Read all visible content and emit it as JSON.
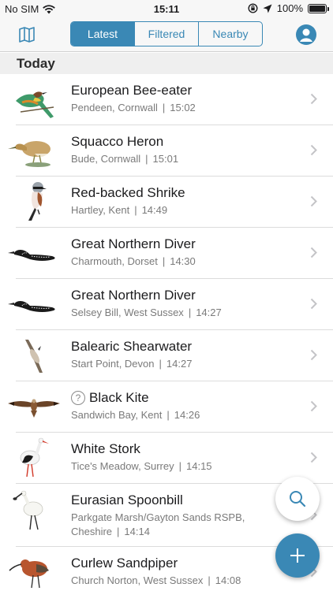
{
  "status_bar": {
    "carrier": "No SIM",
    "time": "15:11",
    "battery": "100%"
  },
  "nav": {
    "tabs": [
      {
        "label": "Latest",
        "active": true
      },
      {
        "label": "Filtered",
        "active": false
      },
      {
        "label": "Nearby",
        "active": false
      }
    ]
  },
  "section": {
    "title": "Today"
  },
  "sightings": [
    {
      "species": "European Bee-eater",
      "location": "Pendeen, Cornwall",
      "time": "15:02"
    },
    {
      "species": "Squacco Heron",
      "location": "Bude, Cornwall",
      "time": "15:01"
    },
    {
      "species": "Red-backed Shrike",
      "location": "Hartley, Kent",
      "time": "14:49"
    },
    {
      "species": "Great Northern Diver",
      "location": "Charmouth, Dorset",
      "time": "14:30"
    },
    {
      "species": "Great Northern Diver",
      "location": "Selsey Bill, West Sussex",
      "time": "14:27"
    },
    {
      "species": "Balearic Shearwater",
      "location": "Start Point, Devon",
      "time": "14:27"
    },
    {
      "species": "Black Kite",
      "location": "Sandwich Bay, Kent",
      "time": "14:26",
      "badge": "?"
    },
    {
      "species": "White Stork",
      "location": "Tice's Meadow, Surrey",
      "time": "14:15"
    },
    {
      "species": "Eurasian Spoonbill",
      "location": "Parkgate Marsh/Gayton Sands RSPB, Cheshire",
      "time": "14:14"
    },
    {
      "species": "Curlew Sandpiper",
      "location": "Church Norton, West Sussex",
      "time": "14:08"
    }
  ],
  "separator": "|",
  "colors": {
    "accent": "#3a88b5",
    "subtitle": "#7a7a7a",
    "section_bg": "#efefef"
  },
  "icons": {
    "map": "map-icon",
    "profile": "profile-icon",
    "search": "search-icon",
    "add": "plus-icon",
    "chevron": "chevron-right-icon"
  }
}
